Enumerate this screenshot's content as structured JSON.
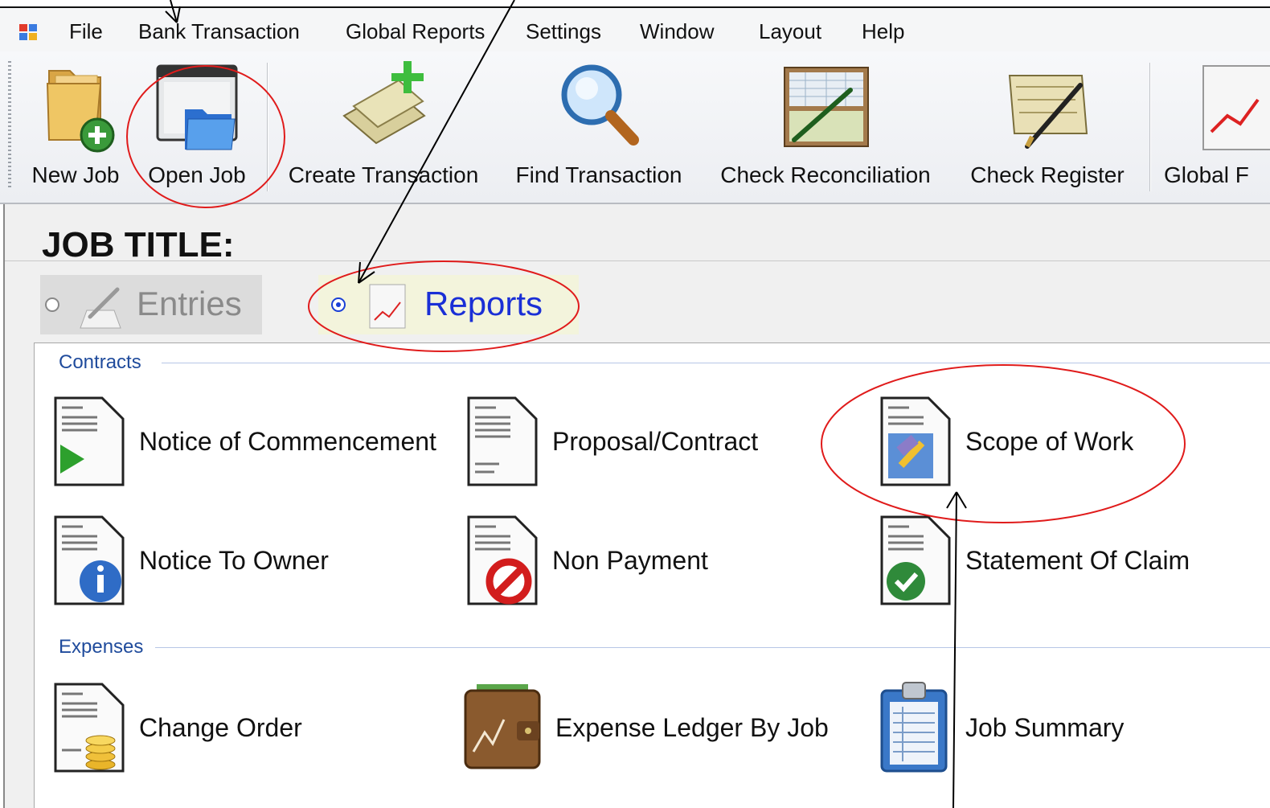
{
  "menu": {
    "items": [
      "File",
      "Bank Transaction",
      "Global Reports",
      "Settings",
      "Window",
      "Layout",
      "Help"
    ]
  },
  "toolbar": {
    "buttons": [
      "New Job",
      "Open Job",
      "Create Transaction",
      "Find Transaction",
      "Check Reconciliation",
      "Check Register",
      "Global F"
    ]
  },
  "panel": {
    "job_title": "JOB TITLE:",
    "view_options": {
      "entries": "Entries",
      "reports": "Reports",
      "selected": "Reports"
    }
  },
  "report_groups": [
    {
      "name": "Contracts",
      "items": [
        "Notice of Commencement",
        "Proposal/Contract",
        "Scope of Work",
        "Notice To Owner",
        "Non Payment",
        "Statement Of Claim"
      ]
    },
    {
      "name": "Expenses",
      "items": [
        "Change Order",
        "Expense Ledger By Job",
        "Job Summary"
      ]
    }
  ],
  "annotation_colors": {
    "circle": "#e01b1b",
    "arrow": "#000000"
  }
}
